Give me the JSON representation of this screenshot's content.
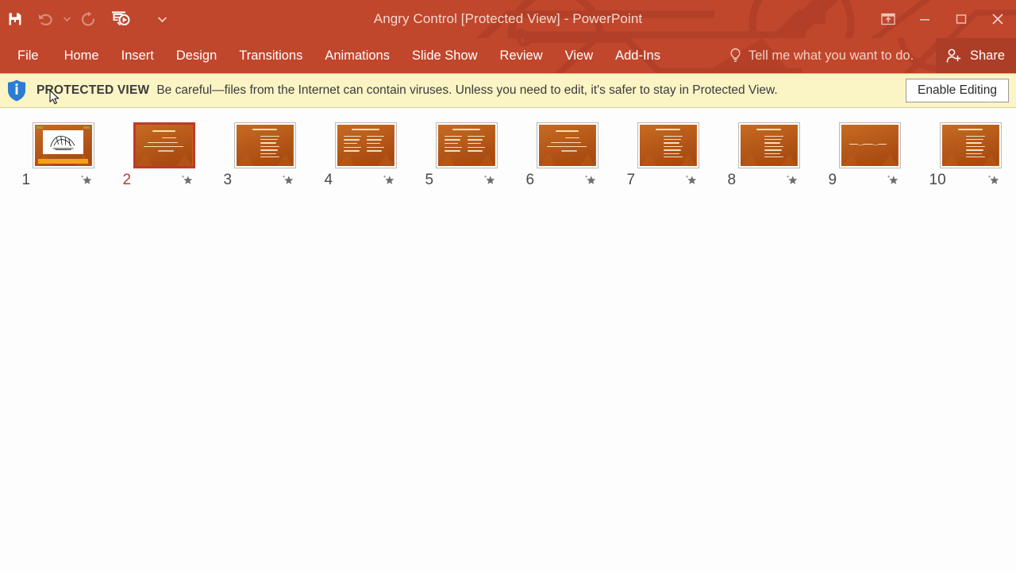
{
  "window": {
    "title": "Angry Control [Protected View] - PowerPoint",
    "theme_color": "#c0462c",
    "share_bg": "#ac3d26"
  },
  "quick_access": {
    "items": [
      {
        "name": "save-button",
        "icon": "save-icon",
        "label": "Save",
        "enabled": true
      },
      {
        "name": "undo-button",
        "icon": "undo-icon",
        "label": "Undo",
        "enabled": false
      },
      {
        "name": "undo-dropdown",
        "icon": "chevron-down-icon",
        "label": "Undo options",
        "enabled": false
      },
      {
        "name": "redo-button",
        "icon": "redo-icon",
        "label": "Redo",
        "enabled": false
      },
      {
        "name": "start-slideshow-button",
        "icon": "slideshow-icon",
        "label": "Start From Beginning",
        "enabled": true
      },
      {
        "name": "customize-qat-button",
        "icon": "chevron-down-icon",
        "label": "Customize Quick Access Toolbar",
        "enabled": true
      }
    ]
  },
  "window_controls": [
    {
      "name": "ribbon-display-options-button",
      "icon": "ribbon-display-icon",
      "label": "Ribbon Display Options"
    },
    {
      "name": "minimize-button",
      "icon": "minimize-icon",
      "label": "Minimize"
    },
    {
      "name": "maximize-button",
      "icon": "maximize-icon",
      "label": "Restore Down"
    },
    {
      "name": "close-button",
      "icon": "close-icon",
      "label": "Close"
    }
  ],
  "ribbon": {
    "tabs": [
      {
        "label": "File",
        "active": false
      },
      {
        "label": "Home",
        "active": false
      },
      {
        "label": "Insert",
        "active": false
      },
      {
        "label": "Design",
        "active": false
      },
      {
        "label": "Transitions",
        "active": false
      },
      {
        "label": "Animations",
        "active": false
      },
      {
        "label": "Slide Show",
        "active": false
      },
      {
        "label": "Review",
        "active": false
      },
      {
        "label": "View",
        "active": false
      },
      {
        "label": "Add-Ins",
        "active": false
      }
    ],
    "tell_me": "Tell me what you want to do.",
    "share_label": "Share"
  },
  "protected_view": {
    "label": "PROTECTED VIEW",
    "message": "Be careful—files from the Internet can contain viruses. Unless you need to edit, it's safer to stay in Protected View.",
    "button_label": "Enable Editing",
    "bar_color": "#fbf4c5",
    "shield_color": "#2b7cd3"
  },
  "slide_sorter": {
    "selected_slide": 2,
    "slides": [
      {
        "number": "1",
        "layout": "image-slide",
        "selected": false
      },
      {
        "number": "2",
        "layout": "title-body",
        "selected": true
      },
      {
        "number": "3",
        "layout": "title-bullets",
        "selected": false
      },
      {
        "number": "4",
        "layout": "two-column",
        "selected": false
      },
      {
        "number": "5",
        "layout": "two-column",
        "selected": false
      },
      {
        "number": "6",
        "layout": "title-body",
        "selected": false
      },
      {
        "number": "7",
        "layout": "title-bullets",
        "selected": false
      },
      {
        "number": "8",
        "layout": "title-bullets",
        "selected": false
      },
      {
        "number": "9",
        "layout": "center-flow",
        "selected": false
      },
      {
        "number": "10",
        "layout": "title-bullets",
        "selected": false
      }
    ],
    "star_icon": "star-icon",
    "thumb_colors": {
      "bg_top": "#c66b22",
      "bg_bottom": "#a84a12",
      "accent_bar": "#f0a21e",
      "text": "#ffe7c9",
      "title_text": "#ffe9b0"
    }
  }
}
